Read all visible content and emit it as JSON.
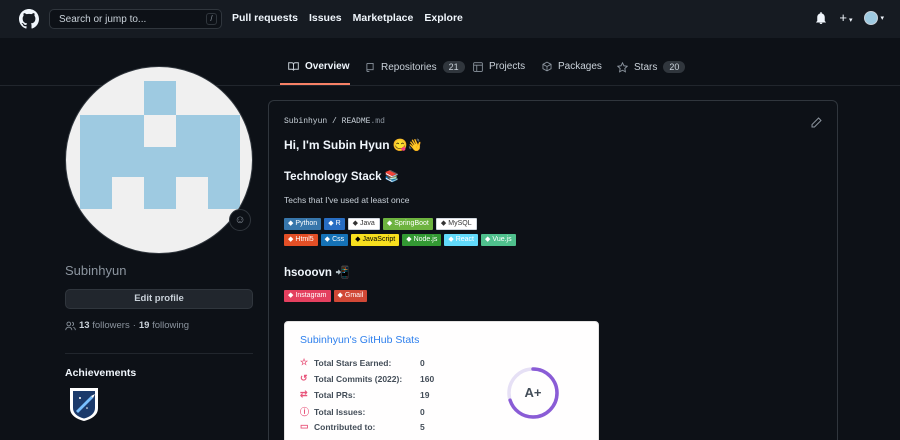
{
  "header": {
    "search_placeholder": "Search or jump to...",
    "search_shortcut": "/",
    "nav": [
      "Pull requests",
      "Issues",
      "Marketplace",
      "Explore"
    ]
  },
  "tabs": [
    {
      "label": "Overview",
      "count": null
    },
    {
      "label": "Repositories",
      "count": "21"
    },
    {
      "label": "Projects",
      "count": null
    },
    {
      "label": "Packages",
      "count": null
    },
    {
      "label": "Stars",
      "count": "20"
    }
  ],
  "sidebar": {
    "username": "Subinhyun",
    "edit_profile": "Edit profile",
    "followers_count": "13",
    "followers_label": "followers",
    "separator": "·",
    "following_count": "19",
    "following_label": "following",
    "achievements_title": "Achievements"
  },
  "readme": {
    "owner": "Subinhyun",
    "slash": "/",
    "file": "README",
    "ext": ".md",
    "greeting": "Hi, I'm Subin Hyun 😋👋",
    "tech_heading": "Technology Stack 📚",
    "tech_subtitle": "Techs that I've used at least once",
    "badges_row1": [
      {
        "label": "Python",
        "color": "#3776ab",
        "fg": "#ffffff"
      },
      {
        "label": "R",
        "color": "#276dc3",
        "fg": "#ffffff"
      },
      {
        "label": "Java",
        "color": "#ffffff",
        "fg": "#333333"
      },
      {
        "label": "SpringBoot",
        "color": "#6db33f",
        "fg": "#ffffff"
      },
      {
        "label": "MySQL",
        "color": "#ffffff",
        "fg": "#333333"
      }
    ],
    "badges_row2": [
      {
        "label": "Html5",
        "color": "#e34f26",
        "fg": "#ffffff"
      },
      {
        "label": "Css",
        "color": "#1572b6",
        "fg": "#ffffff"
      },
      {
        "label": "JavaScript",
        "color": "#f7df1e",
        "fg": "#000000"
      },
      {
        "label": "Node.js",
        "color": "#339933",
        "fg": "#ffffff"
      },
      {
        "label": "React",
        "color": "#61dafb",
        "fg": "#ffffff"
      },
      {
        "label": "Vue.js",
        "color": "#4fc08d",
        "fg": "#ffffff"
      }
    ],
    "contact_heading": "hsooovn 📲",
    "badges_row3": [
      {
        "label": "Instagram",
        "color": "#e4405f",
        "fg": "#ffffff"
      },
      {
        "label": "Gmail",
        "color": "#d14836",
        "fg": "#ffffff"
      }
    ]
  },
  "stats": {
    "title": "Subinhyun's GitHub Stats",
    "rows": [
      {
        "icon": "star-icon",
        "label": "Total Stars Earned:",
        "value": "0"
      },
      {
        "icon": "history-icon",
        "label": "Total Commits (2022):",
        "value": "160"
      },
      {
        "icon": "pull-request-icon",
        "label": "Total PRs:",
        "value": "19"
      },
      {
        "icon": "issue-icon",
        "label": "Total Issues:",
        "value": "0"
      },
      {
        "icon": "repo-icon",
        "label": "Contributed to:",
        "value": "5"
      }
    ],
    "rank": "A+",
    "rank_progress": 0.7
  },
  "colors": {
    "bg": "#0d1117",
    "header_bg": "#161b22",
    "accent_underline": "#f78166",
    "identicon": "#9ecae1",
    "stats_title": "#2f80ed",
    "stats_icon": "#e8557b"
  }
}
